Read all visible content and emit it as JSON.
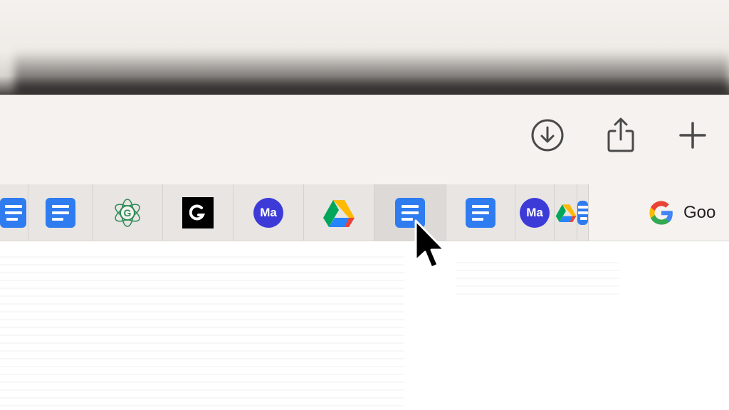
{
  "toolbar": {
    "buttons": [
      {
        "name": "downloads",
        "icon": "download-icon"
      },
      {
        "name": "share",
        "icon": "share-icon"
      },
      {
        "name": "new-tab",
        "icon": "plus-icon"
      }
    ],
    "icon_color": "#4a4a4a"
  },
  "pinned_tabs": [
    {
      "icon": "google-docs-icon",
      "partial": true
    },
    {
      "icon": "google-docs-icon"
    },
    {
      "icon": "green-g-logo-icon"
    },
    {
      "icon": "black-square-logo-icon"
    },
    {
      "icon": "ma-avatar-icon",
      "text": "Ma"
    },
    {
      "icon": "google-drive-icon"
    },
    {
      "icon": "google-docs-icon",
      "hover": true
    },
    {
      "icon": "google-docs-icon"
    },
    {
      "icon": "ma-avatar-icon",
      "text": "Ma"
    },
    {
      "icon": "google-drive-icon",
      "partial": true
    },
    {
      "icon": "google-docs-icon",
      "partial": true
    }
  ],
  "google_tab": {
    "icon": "google-g-icon",
    "label": "Goo"
  },
  "colors": {
    "docs_blue": "#2f7cf0",
    "ma_purple": "#3d3bd8",
    "toolbar_bg": "#f5f2ef"
  }
}
